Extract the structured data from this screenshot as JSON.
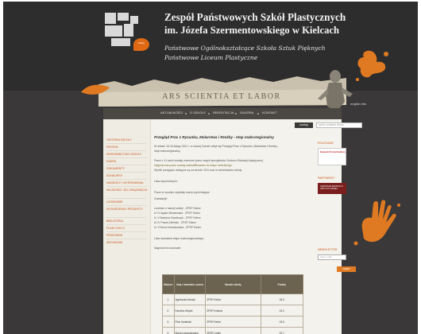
{
  "header": {
    "title_line1": "Zespół Państwowych Szkół Plastycznych",
    "title_line2": "im. Józefa Szermentowskiego w Kielcach",
    "subtitle_line1": "Państwowe Ogólnokształcące Szkoła Sztuk Pięknych",
    "subtitle_line2": "Państwowe Liceum Plastyczne",
    "motto": "ARS SCIENTIA ET LABOR",
    "logo_badge": "Kielce"
  },
  "nav": {
    "items": [
      "AKTUALNOŚCI",
      "O SZKOLE",
      "REKRUTACJA",
      "GALERIA",
      "KONTAKT"
    ],
    "corner_link": "english info"
  },
  "search": {
    "button_label": "szukaj",
    "placeholder": "wpisz szukane słowo"
  },
  "sidebar_left": {
    "items": [
      "HISTORIA SZKOŁY",
      "PATRON",
      "KIEROWNICTWO SZKOŁY",
      "KADRA",
      "DOKUMENTY",
      "KONKURSY",
      "NAGRODY I WYRÓŻNIENIA",
      "MŁODZIEŻ I JEJ OSIĄGNIĘCIA",
      "UCZNIOWIE",
      "WYDARZENIA I PROJEKTY",
      "BIBLIOTEKA",
      "PLAN LEKCJI",
      "PRZETARGI",
      "ARCHIWUM"
    ]
  },
  "article": {
    "title": "Przegląd Prac z Rysunku, Malarstwa i Rzeźby - etap makroregionalny",
    "paragraphs": [
      "W dniach 16-18 lutego 2011 r. w naszej Szkole odbył się Przegląd Prac z Rysunku, Malarstwa i Rzeźby -",
      "etap makroregionalny.",
      "Prace z 11 szkół zostały ocenione przez zespół specjalistów Centrum Edukacji Artystycznej.",
      "Nagrodzone prace zostały zakwalifikowane do etapu centralnego.",
      "Wyniki przeglądu dostępne są na stronie CEA oraz w sekretariacie szkoły.",
      "Lista wyróżnionych:",
      "Prace w rysunku uzyskały oceny wyróżniające:",
      "Gratulacje!",
      "Laureaci z naszej szkoły - ZPSP Kielce",
      "kl. IV Agata Wiśniewska - ZPSP Kielce",
      "kl. V Martyna Kowalczyk - ZPSP Kielce",
      "kl. IV Paweł Zieliński - ZPSP Kielce",
      "kl. VI Anna Nowakowska - ZPSP Kielce",
      "Lista laureatów etapu makroregionalnego:",
      "Nagrodzeni uczniowie:"
    ],
    "table": {
      "headers": [
        "Miejsce",
        "Imię i nazwisko ucznia",
        "Nazwa szkoły",
        "Punkty"
      ],
      "rows": [
        [
          "1.",
          "Agnieszka Nowak",
          "ZPSP Kielce",
          "25,5"
        ],
        [
          "2.",
          "Karolina Wójcik",
          "ZPSP Kraków",
          "24,0"
        ],
        [
          "3.",
          "Piotr Kamiński",
          "ZPSP Kielce",
          "23,5"
        ],
        [
          "4.",
          "Maria Lewandowska",
          "ZPSP Lublin",
          "22,7"
        ]
      ]
    }
  },
  "sidebar_right": {
    "label1": "POLECAMY",
    "banner1_text": "Kielecki Portal Kultury",
    "label2": "PARTNERZY",
    "banner2_text": "CENTRUM EDUKACJI ARTYSTYCZNEJ",
    "label3": "NEWSLETTER",
    "newsletter_placeholder": "twój e-mail",
    "newsletter_button": "zapisz"
  },
  "colors": {
    "background": "#3a3838",
    "accent": "#e07a22",
    "content_bg": "#f4f2ec",
    "link": "#c7541a"
  }
}
